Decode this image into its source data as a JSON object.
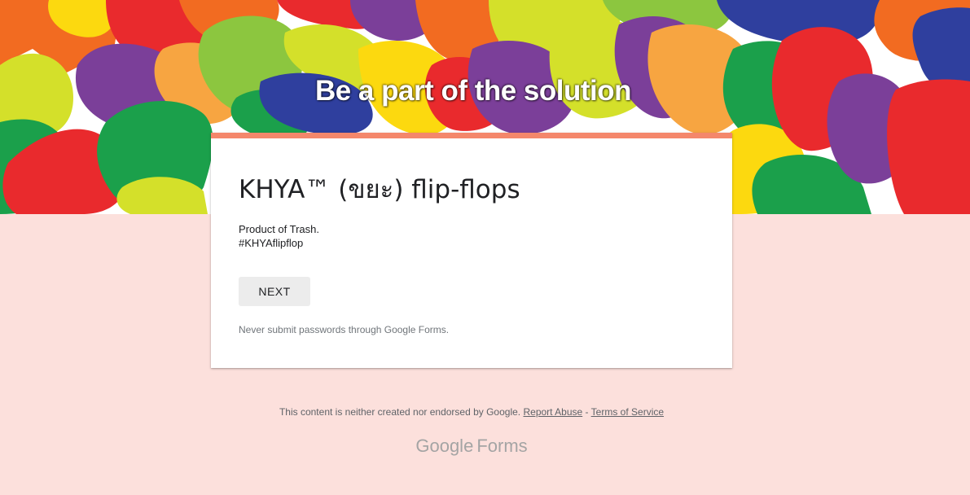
{
  "banner": {
    "title": "Be a part of the solution"
  },
  "form": {
    "title": "KHYA™ (ขยะ) flip-flops",
    "description_lines": [
      "Product of Trash.",
      "#KHYAflipflop"
    ],
    "next_label": "NEXT",
    "warning": "Never submit passwords through Google Forms."
  },
  "footer": {
    "disclaimer": "This content is neither created nor endorsed by Google.",
    "report_abuse": "Report Abuse",
    "separator": "-",
    "terms": "Terms of Service"
  },
  "brand": {
    "google": "Google",
    "forms": "Forms"
  },
  "colors": {
    "page_background": "#fce0dc",
    "card_accent": "#f4876b",
    "button_background": "#ececec",
    "banner_palette": [
      "#e92a2d",
      "#f26b21",
      "#fcd90f",
      "#d4e02a",
      "#8cc63f",
      "#1ba04b",
      "#7b3f99",
      "#2f3f9e",
      "#f7a541"
    ]
  }
}
